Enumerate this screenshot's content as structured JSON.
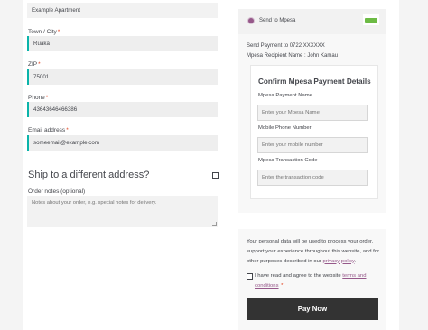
{
  "billing": {
    "apartment_value": "Example Apartment",
    "town_label": "Town / City",
    "town_value": "Ruaka",
    "zip_label": "ZIP",
    "zip_value": "75001",
    "phone_label": "Phone",
    "phone_value": "43643646466386",
    "email_label": "Email address",
    "email_value": "someemail@example.com",
    "required_mark": "*"
  },
  "shipping": {
    "title": "Ship to a different address?",
    "order_notes_label": "Order notes (optional)",
    "order_notes_placeholder": "Notes about your order, e.g. special notes for delivery."
  },
  "payment": {
    "method_label": "Send to Mpesa",
    "logo_icon": "mpesa-logo",
    "instruction_line1": "Send Payment to 0722 XXXXXX",
    "instruction_line2": "Mpesa Recipient Name : John Kamau",
    "confirm_title": "Confirm Mpesa Payment Details",
    "name_label": "Mpesa Payment Name",
    "name_placeholder": "Enter your Mpesa Name",
    "phone_label": "Mobile Phone Number",
    "phone_placeholder": "Enter your mobile number",
    "code_label": "Mpesa Transaction Code",
    "code_placeholder": "Enter the transaction code"
  },
  "privacy": {
    "text": "Your personal data will be used to process your order, support your experience throughout this website, and for other purposes described in our",
    "link": "privacy policy",
    "period": "."
  },
  "terms": {
    "text": "I have read and agree to the website",
    "link": "terms and conditions",
    "required_mark": "*"
  },
  "actions": {
    "pay_label": "Pay Now"
  },
  "colors": {
    "accent": "#96588a",
    "active_field": "#0bb4aa",
    "required": "#e2401c",
    "button": "#333333"
  }
}
